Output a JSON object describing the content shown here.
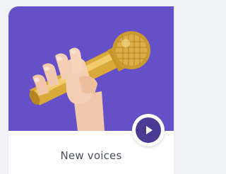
{
  "card": {
    "title": "New voices",
    "thumbnail_icon": "microphone-in-hand",
    "play_icon": "play-icon"
  },
  "colors": {
    "page_background": "#f2f3f6",
    "thumbnail_background": "#6650c8",
    "play_circle": "#4a3a94",
    "title_text": "#4a4d5c"
  }
}
